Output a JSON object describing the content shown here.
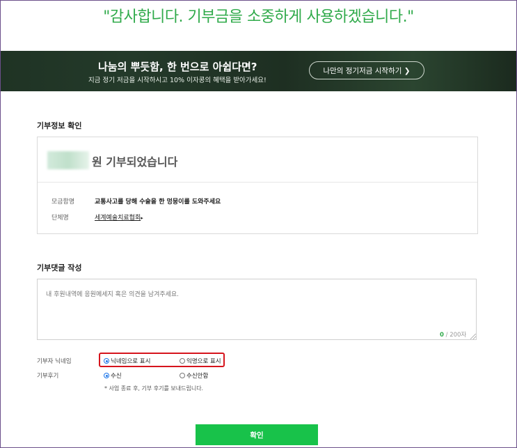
{
  "header": {
    "thanks_message": "\"감사합니다. 기부금을 소중하게 사용하겠습니다.\""
  },
  "banner": {
    "title": "나눔의 뿌듯함, 한 번으로 아쉽다면?",
    "subtitle": "지금 정기 저금을 시작하시고 10% 이자콩의 혜택을 받아가세요!",
    "button_label": "나만의 정기저금 시작하기 ❯"
  },
  "donation_info": {
    "section_title": "기부정보 확인",
    "donated_text": "원 기부되었습니다",
    "fund_label": "모금함명",
    "fund_value": "교통사고를 당해 수술을 한 멍뭉이를 도와주세요",
    "org_label": "단체명",
    "org_value": "세계예술치료협회",
    "org_arrow": "▸"
  },
  "comment": {
    "section_title": "기부댓글 작성",
    "placeholder": "내 후원내역에 응원메세지 혹은 의견을 남겨주세요.",
    "count": "0",
    "max": " / 200자"
  },
  "options": {
    "nickname_label": "기부자 닉네임",
    "nickname_option1": "닉네임으로 표시",
    "nickname_option2": "익명으로 표시",
    "review_label": "기부후기",
    "review_option1": "수신",
    "review_option2": "수신안함",
    "note": "* 사업 종료 후, 기부 후기를 보내드립니다."
  },
  "actions": {
    "confirm_label": "확인"
  },
  "colors": {
    "accent": "#2faa4a",
    "button": "#18c24a",
    "highlight": "#d6141c"
  }
}
